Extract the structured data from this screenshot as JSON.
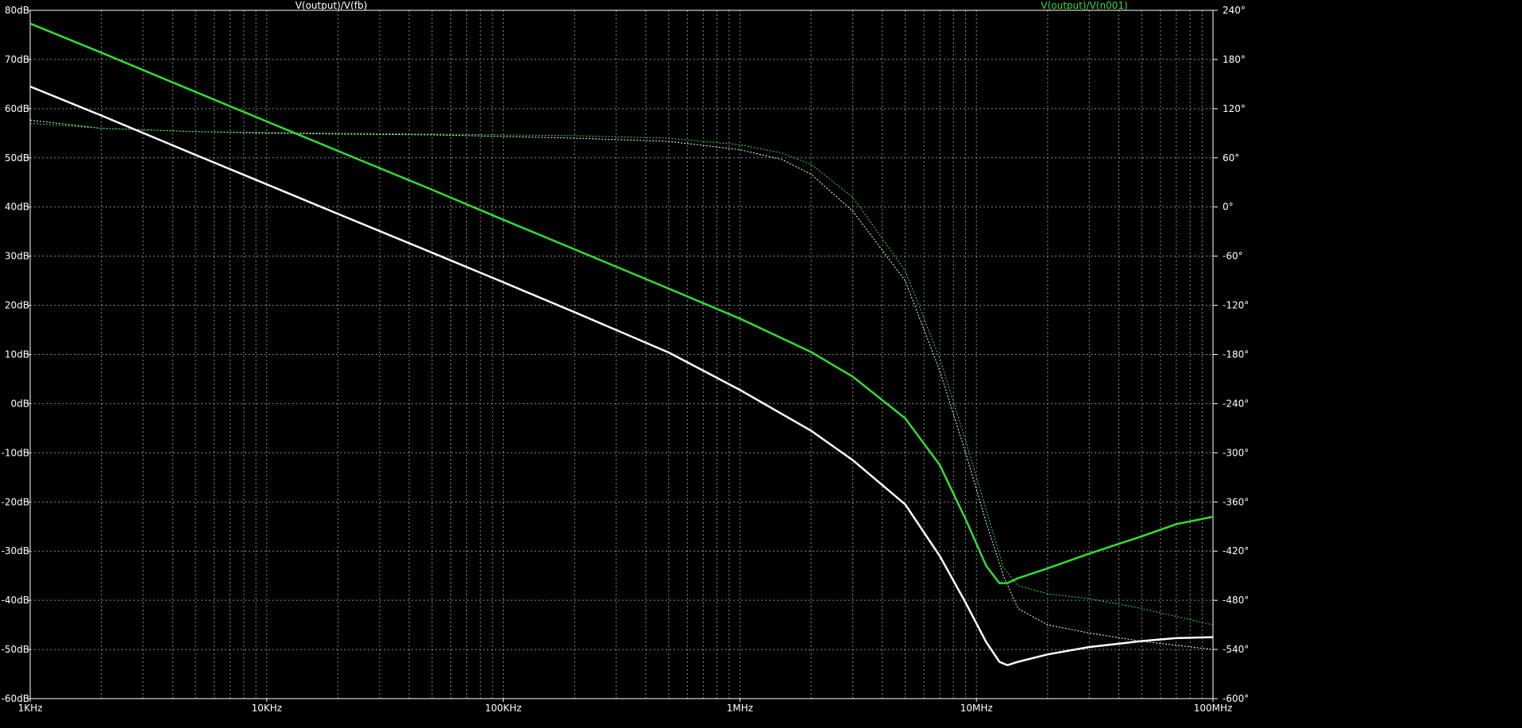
{
  "chart_data": {
    "type": "line",
    "title": "",
    "x_scale": "log",
    "x_unit": "Hz",
    "xlim": [
      1000,
      100000000
    ],
    "ylim_left": [
      -60,
      80
    ],
    "ylim_right": [
      -600,
      240
    ],
    "ylabel_left_unit": "dB",
    "ylabel_right_unit": "°",
    "grid": true,
    "grid_style": "dotted",
    "background": "#000000",
    "x_ticks": [
      {
        "value": 1000,
        "label": "1KHz"
      },
      {
        "value": 10000,
        "label": "10KHz"
      },
      {
        "value": 100000,
        "label": "100KHz"
      },
      {
        "value": 1000000,
        "label": "1MHz"
      },
      {
        "value": 10000000,
        "label": "10MHz"
      },
      {
        "value": 100000000,
        "label": "100MHz"
      }
    ],
    "y_left_ticks": [
      {
        "value": 80,
        "label": "80dB"
      },
      {
        "value": 70,
        "label": "70dB"
      },
      {
        "value": 60,
        "label": "60dB"
      },
      {
        "value": 50,
        "label": "50dB"
      },
      {
        "value": 40,
        "label": "40dB"
      },
      {
        "value": 30,
        "label": "30dB"
      },
      {
        "value": 20,
        "label": "20dB"
      },
      {
        "value": 10,
        "label": "10dB"
      },
      {
        "value": 0,
        "label": "0dB"
      },
      {
        "value": -10,
        "label": "-10dB"
      },
      {
        "value": -20,
        "label": "-20dB"
      },
      {
        "value": -30,
        "label": "-30dB"
      },
      {
        "value": -40,
        "label": "-40dB"
      },
      {
        "value": -50,
        "label": "-50dB"
      },
      {
        "value": -60,
        "label": "-60dB"
      }
    ],
    "y_right_ticks": [
      {
        "value": 240,
        "label": "240°"
      },
      {
        "value": 180,
        "label": "180°"
      },
      {
        "value": 120,
        "label": "120°"
      },
      {
        "value": 60,
        "label": "60°"
      },
      {
        "value": 0,
        "label": "0°"
      },
      {
        "value": -60,
        "label": "-60°"
      },
      {
        "value": -120,
        "label": "-120°"
      },
      {
        "value": -180,
        "label": "-180°"
      },
      {
        "value": -240,
        "label": "-240°"
      },
      {
        "value": -300,
        "label": "-300°"
      },
      {
        "value": -360,
        "label": "-360°"
      },
      {
        "value": -420,
        "label": "-420°"
      },
      {
        "value": -480,
        "label": "-480°"
      },
      {
        "value": -540,
        "label": "-540°"
      },
      {
        "value": -600,
        "label": "-600°"
      }
    ],
    "series": [
      {
        "name": "V(output)/V(fb)",
        "color": "#ffffff",
        "magnitude_db": [
          [
            1000,
            64.5
          ],
          [
            2000,
            58.6
          ],
          [
            5000,
            50.6
          ],
          [
            10000,
            44.6
          ],
          [
            20000,
            38.6
          ],
          [
            50000,
            30.7
          ],
          [
            100000,
            24.7
          ],
          [
            200000,
            18.6
          ],
          [
            500000,
            10.4
          ],
          [
            1000000,
            2.8
          ],
          [
            2000000,
            -5.5
          ],
          [
            3000000,
            -11.5
          ],
          [
            5000000,
            -20.5
          ],
          [
            7000000,
            -31.0
          ],
          [
            9000000,
            -40.5
          ],
          [
            11000000,
            -48.5
          ],
          [
            12500000,
            -52.5
          ],
          [
            13500000,
            -53.2
          ],
          [
            15000000,
            -52.5
          ],
          [
            20000000,
            -51.0
          ],
          [
            30000000,
            -49.5
          ],
          [
            50000000,
            -48.3
          ],
          [
            70000000,
            -47.7
          ],
          [
            100000000,
            -47.5
          ]
        ],
        "phase_deg": [
          [
            1000,
            106
          ],
          [
            2000,
            96
          ],
          [
            5000,
            92
          ],
          [
            10000,
            90
          ],
          [
            20000,
            89
          ],
          [
            50000,
            88
          ],
          [
            100000,
            86
          ],
          [
            200000,
            84
          ],
          [
            500000,
            80
          ],
          [
            1000000,
            70
          ],
          [
            1500000,
            58
          ],
          [
            2000000,
            40
          ],
          [
            3000000,
            -5
          ],
          [
            5000000,
            -90
          ],
          [
            7000000,
            -200
          ],
          [
            9000000,
            -300
          ],
          [
            11000000,
            -385
          ],
          [
            13000000,
            -450
          ],
          [
            15000000,
            -490
          ],
          [
            20000000,
            -510
          ],
          [
            30000000,
            -520
          ],
          [
            50000000,
            -530
          ],
          [
            100000000,
            -540
          ]
        ]
      },
      {
        "name": "V(output)/V(n001)",
        "color": "#33dd33",
        "magnitude_db": [
          [
            1000,
            77.3
          ],
          [
            2000,
            71.4
          ],
          [
            5000,
            63.4
          ],
          [
            10000,
            57.4
          ],
          [
            20000,
            51.4
          ],
          [
            50000,
            43.5
          ],
          [
            100000,
            37.4
          ],
          [
            200000,
            31.4
          ],
          [
            500000,
            23.4
          ],
          [
            1000000,
            17.3
          ],
          [
            2000000,
            10.5
          ],
          [
            3000000,
            5.5
          ],
          [
            5000000,
            -3.0
          ],
          [
            7000000,
            -12.5
          ],
          [
            9000000,
            -23.5
          ],
          [
            11000000,
            -33.0
          ],
          [
            12500000,
            -36.5
          ],
          [
            13500000,
            -36.5
          ],
          [
            15000000,
            -35.5
          ],
          [
            20000000,
            -33.5
          ],
          [
            30000000,
            -30.5
          ],
          [
            50000000,
            -27.0
          ],
          [
            70000000,
            -24.5
          ],
          [
            100000000,
            -23.0
          ]
        ],
        "phase_deg": [
          [
            1000,
            102
          ],
          [
            2000,
            96
          ],
          [
            5000,
            92
          ],
          [
            10000,
            91
          ],
          [
            20000,
            90
          ],
          [
            50000,
            89
          ],
          [
            100000,
            88
          ],
          [
            200000,
            87
          ],
          [
            500000,
            84
          ],
          [
            1000000,
            76
          ],
          [
            1500000,
            66
          ],
          [
            2000000,
            52
          ],
          [
            3000000,
            12
          ],
          [
            5000000,
            -78
          ],
          [
            7000000,
            -185
          ],
          [
            9000000,
            -285
          ],
          [
            11000000,
            -370
          ],
          [
            13000000,
            -440
          ],
          [
            15000000,
            -462
          ],
          [
            20000000,
            -472
          ],
          [
            30000000,
            -478
          ],
          [
            50000000,
            -490
          ],
          [
            100000000,
            -510
          ]
        ]
      }
    ]
  }
}
